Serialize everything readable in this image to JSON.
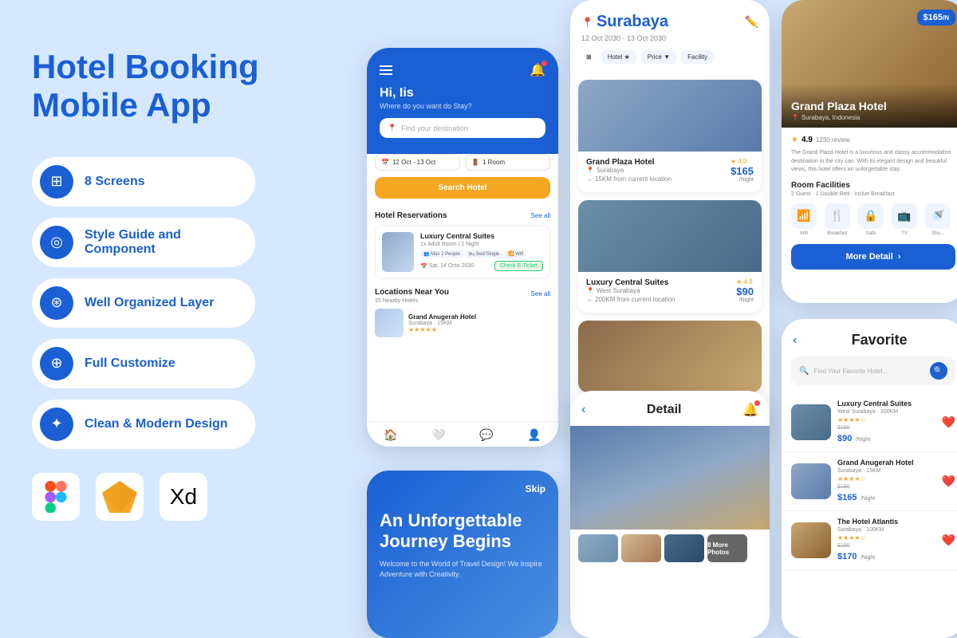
{
  "page": {
    "background": "#d6e8ff",
    "title": "Hotel Booking Mobile App"
  },
  "left": {
    "title_line1": "Hotel Booking",
    "title_line2": "Mobile App",
    "features": [
      {
        "id": "screens",
        "label": "8 Screens",
        "icon": "⊞"
      },
      {
        "id": "style-guide",
        "label": "Style Guide and Component",
        "icon": "◎"
      },
      {
        "id": "layers",
        "label": "Well Organized Layer",
        "icon": "⊛"
      },
      {
        "id": "customize",
        "label": "Full Customize",
        "icon": "⊕"
      },
      {
        "id": "design",
        "label": "Clean & Modern Design",
        "icon": "✦"
      }
    ],
    "tools": [
      {
        "name": "Figma",
        "icon": "figma"
      },
      {
        "name": "Sketch",
        "icon": "sketch"
      },
      {
        "name": "Adobe XD",
        "icon": "xd"
      }
    ]
  },
  "phone1": {
    "greeting": "Hi, Iis",
    "subtitle": "Where do you want do Stay?",
    "search_placeholder": "Find your destination",
    "date": "12 Oct - 13 Oct",
    "room": "1 Room",
    "search_btn": "Search Hotel",
    "section_reservations": "Hotel Reservations",
    "see_all": "See all",
    "reservation": {
      "name": "Luxury Central Suites",
      "details": "1x Adult Room | 1 Night",
      "tags": [
        "Max 2 People",
        "Bed Single",
        "Wifi"
      ],
      "date": "Sat, 14 Octo 2030",
      "check_btn": "Check E-Ticket"
    },
    "section_locations": "Locations Near You",
    "nearby_count": "15 Nearby Hotels",
    "location": {
      "name": "Grand Anugerah Hotel",
      "distance": "Surabaya · 15KM"
    }
  },
  "phone2": {
    "city": "Surabaya",
    "dates": "12 Oct 2030 - 13 Oct 2030",
    "filters": [
      "Hotel ★",
      "Price ▼",
      "Facility"
    ],
    "hotels": [
      {
        "name": "Grand Plaza Hotel",
        "location": "Surabaya",
        "distance": "15KM from current location",
        "rating": "4.9",
        "price": "$165",
        "price_unit": "/Night"
      },
      {
        "name": "Luxury Central Suites",
        "location": "West Surabaya",
        "distance": "200KM from current location",
        "rating": "4.9",
        "price": "$90",
        "price_unit": "/Night"
      }
    ]
  },
  "phone3": {
    "header": "Detail",
    "more_photos": "8 More Photos"
  },
  "phone4": {
    "hotel_name": "Grand Plaza Hotel",
    "hotel_location": "Surabaya, Indonesia",
    "price": "$165",
    "price_unit": "/N",
    "rating": "4.9",
    "review_count": "1230 review",
    "description": "The Grand Plaza Hotel is a luxurious and classy accommodation destination in the city can. With its elegant design and beautiful views, this hotel offers an unforgettable stay.",
    "facilities_title": "Room Facilities",
    "facilities_sub": "2 Guest · 1 Double Bed · Inclue Breakfast",
    "facilities": [
      {
        "name": "Wifi",
        "icon": "📶"
      },
      {
        "name": "Breakfast",
        "icon": "🍴"
      },
      {
        "name": "Safe",
        "icon": "📺"
      },
      {
        "name": "TV",
        "icon": "🖥"
      },
      {
        "name": "Shower",
        "icon": "🚿"
      }
    ],
    "more_detail_btn": "More Detail"
  },
  "phone5": {
    "title": "Favorite",
    "search_placeholder": "Find Your Favorite Hotel...",
    "favorites": [
      {
        "name": "Luxury Central Suites",
        "location": "West Surabaya · 200KM",
        "rating": "★★★★☆",
        "old_price": "$190",
        "new_price": "$90",
        "price_unit": "/Night"
      },
      {
        "name": "Grand Anugerah Hotel",
        "location": "Surabaya · 15KM",
        "rating": "★★★★☆",
        "old_price": "$190",
        "new_price": "$165",
        "price_unit": "/Night"
      },
      {
        "name": "The Hotel Atlantis",
        "location": "Surabaya · 100KM",
        "rating": "★★★★☆",
        "old_price": "$190",
        "new_price": "$170",
        "price_unit": "/Night"
      }
    ]
  },
  "phone6": {
    "skip": "Skip",
    "title_line1": "An Unforgettable",
    "title_line2": "Journey Begins",
    "subtitle": "Welcome to the World of Travel Design! We Inspire Adventure with Creativity."
  }
}
